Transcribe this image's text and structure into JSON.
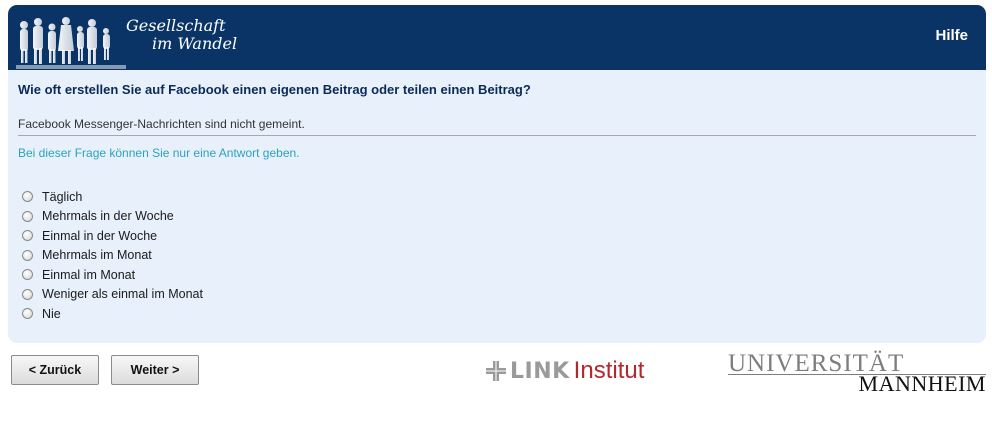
{
  "header": {
    "brand_line1": "Gesellschaft",
    "brand_line2": "im Wandel",
    "help_label": "Hilfe",
    "colors": {
      "bar": "#0b3466",
      "panel": "#e8f0fb"
    }
  },
  "question": {
    "text": "Wie oft erstellen Sie auf Facebook einen eigenen Beitrag oder teilen einen Beitrag?",
    "note": "Facebook Messenger-Nachrichten sind nicht gemeint.",
    "hint": "Bei dieser Frage können Sie nur eine Antwort geben.",
    "hint_color": "#2ba2bf",
    "options": [
      {
        "label": "Täglich",
        "selected": false
      },
      {
        "label": "Mehrmals in der Woche",
        "selected": false
      },
      {
        "label": "Einmal in der Woche",
        "selected": false
      },
      {
        "label": "Mehrmals im Monat",
        "selected": false
      },
      {
        "label": "Einmal im Monat",
        "selected": false
      },
      {
        "label": "Weniger als einmal im Monat",
        "selected": false
      },
      {
        "label": "Nie",
        "selected": false
      }
    ]
  },
  "nav": {
    "back_label": "< Zurück",
    "next_label": "Weiter >"
  },
  "logos": {
    "link_word": "LINK",
    "link_institut": "Institut",
    "uni_line1": "UNIVERSITÄT",
    "uni_line2": "MANNHEIM"
  }
}
